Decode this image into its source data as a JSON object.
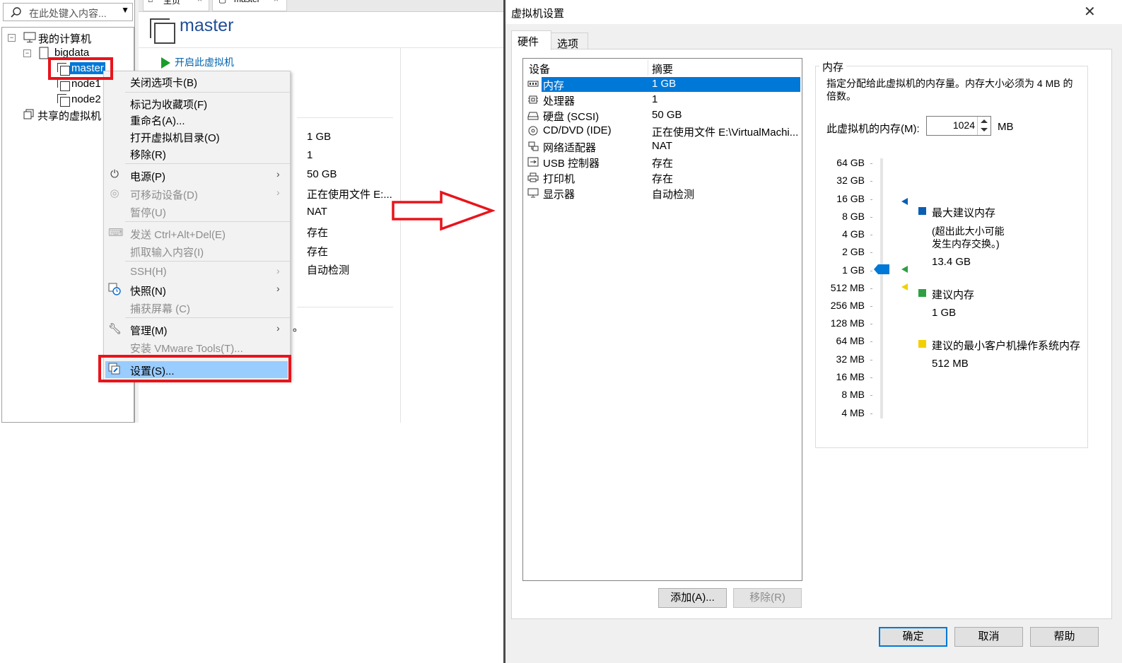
{
  "left_window": {
    "search_placeholder": "在此处键入内容...",
    "tabs": [
      {
        "label": "主页"
      },
      {
        "label": "master"
      }
    ],
    "tree": {
      "my_computer": "我的计算机",
      "folder": "bigdata",
      "vms": [
        "master",
        "node1",
        "node2"
      ],
      "shared": "共享的虚拟机"
    },
    "vm_title": "master",
    "start_vm": "开启此虚拟机",
    "details_values": [
      "1 GB",
      "1",
      "50 GB",
      "正在使用文件 E:...",
      "NAT",
      "存在",
      "存在",
      "自动检测"
    ],
    "stray_char": "。"
  },
  "context_menu": {
    "items": [
      {
        "label": "关闭选项卡(B)",
        "enabled": true
      },
      {
        "label": "标记为收藏项(F)",
        "enabled": true
      },
      {
        "label": "重命名(A)...",
        "enabled": true
      },
      {
        "label": "打开虚拟机目录(O)",
        "enabled": true
      },
      {
        "label": "移除(R)",
        "enabled": true
      },
      {
        "label": "电源(P)",
        "enabled": true,
        "submenu": true,
        "icon": "power-icon"
      },
      {
        "label": "可移动设备(D)",
        "enabled": false,
        "submenu": true,
        "icon": "removable-device-icon"
      },
      {
        "label": "暂停(U)",
        "enabled": false
      },
      {
        "label": "发送 Ctrl+Alt+Del(E)",
        "enabled": false,
        "icon": "send-keys-icon"
      },
      {
        "label": "抓取输入内容(I)",
        "enabled": false
      },
      {
        "label": "SSH(H)",
        "enabled": false,
        "submenu": true
      },
      {
        "label": "快照(N)",
        "enabled": true,
        "submenu": true,
        "icon": "snapshot-icon"
      },
      {
        "label": "捕获屏幕 (C)",
        "enabled": false
      },
      {
        "label": "管理(M)",
        "enabled": true,
        "submenu": true,
        "icon": "wrench-icon"
      },
      {
        "label": "安装 VMware Tools(T)...",
        "enabled": false
      },
      {
        "label": "设置(S)...",
        "enabled": true,
        "highlighted": true,
        "icon": "settings-icon"
      }
    ],
    "submenu_arrow": "›"
  },
  "dialog": {
    "title": "虚拟机设置",
    "close": "✕",
    "tabs": {
      "hardware": "硬件",
      "options": "选项"
    },
    "device_table": {
      "headers": {
        "device": "设备",
        "summary": "摘要"
      },
      "rows": [
        {
          "name": "内存",
          "summary": "1 GB",
          "icon": "memory-icon",
          "selected": true
        },
        {
          "name": "处理器",
          "summary": "1",
          "icon": "cpu-icon"
        },
        {
          "name": "硬盘 (SCSI)",
          "summary": "50 GB",
          "icon": "hard-disk-icon"
        },
        {
          "name": "CD/DVD (IDE)",
          "summary": "正在使用文件 E:\\VirtualMachi...",
          "icon": "cd-dvd-icon"
        },
        {
          "name": "网络适配器",
          "summary": "NAT",
          "icon": "network-adapter-icon"
        },
        {
          "name": "USB 控制器",
          "summary": "存在",
          "icon": "usb-icon"
        },
        {
          "name": "打印机",
          "summary": "存在",
          "icon": "printer-icon"
        },
        {
          "name": "显示器",
          "summary": "自动检测",
          "icon": "display-icon"
        }
      ]
    },
    "buttons": {
      "add": "添加(A)...",
      "remove": "移除(R)",
      "ok": "确定",
      "cancel": "取消",
      "help": "帮助"
    },
    "memory": {
      "group_title": "内存",
      "description": "指定分配给此虚拟机的内存量。内存大小必须为 4 MB 的倍数。",
      "label": "此虚拟机的内存(M):",
      "value": "1024",
      "unit": "MB",
      "scale": [
        "64 GB",
        "32 GB",
        "16 GB",
        "8 GB",
        "4 GB",
        "2 GB",
        "1 GB",
        "512 MB",
        "256 MB",
        "128 MB",
        "64 MB",
        "32 MB",
        "16 MB",
        "8 MB",
        "4 MB"
      ],
      "current_level": "1 GB",
      "legend": {
        "max_recommended": {
          "label": "最大建议内存",
          "note_line1": "(超出此大小可能",
          "note_line2": "发生内存交换。)",
          "value": "13.4 GB",
          "color": "#0a5fb4"
        },
        "recommended": {
          "label": "建议内存",
          "value": "1 GB",
          "color": "#2ea043"
        },
        "min_guest": {
          "label": "建议的最小客户机操作系统内存",
          "value": "512 MB",
          "color": "#f2d000"
        }
      }
    }
  }
}
